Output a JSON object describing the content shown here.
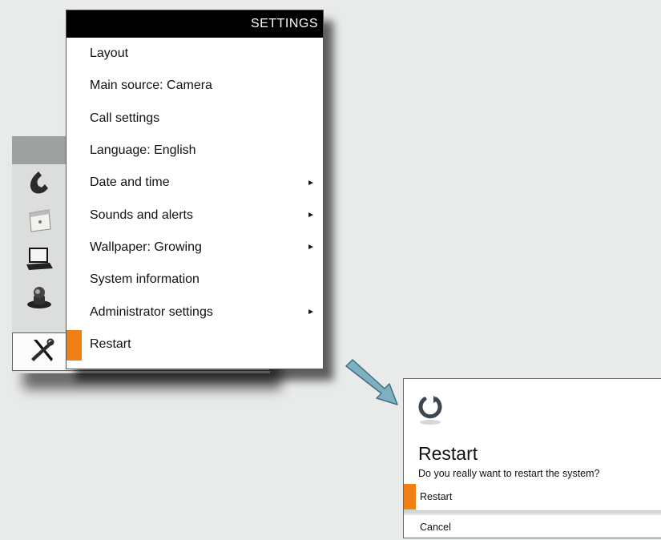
{
  "settings_menu": {
    "header": "SETTINGS",
    "items": [
      {
        "label": "Layout",
        "has_submenu": false
      },
      {
        "label": "Main source: Camera",
        "has_submenu": false
      },
      {
        "label": "Call settings",
        "has_submenu": false
      },
      {
        "label": "Language: English",
        "has_submenu": false
      },
      {
        "label": "Date and time",
        "has_submenu": true
      },
      {
        "label": "Sounds and alerts",
        "has_submenu": true
      },
      {
        "label": "Wallpaper: Growing",
        "has_submenu": true
      },
      {
        "label": "System information",
        "has_submenu": false
      },
      {
        "label": "Administrator settings",
        "has_submenu": true
      },
      {
        "label": "Restart",
        "has_submenu": false,
        "selected": true
      }
    ],
    "submenu_arrow": "►"
  },
  "sidebar": {
    "icons": [
      "phone-icon",
      "calendar-icon",
      "laptop-icon",
      "camera-icon",
      "tools-icon"
    ]
  },
  "dialog": {
    "icon": "restart-icon",
    "title": "Restart",
    "message": "Do you really want to restart the system?",
    "options": {
      "restart": "Restart",
      "cancel": "Cancel"
    }
  },
  "colors": {
    "accent": "#f07f16",
    "header_bg": "#000000",
    "background": "#e9ebea",
    "arrow": "#7fb0c2"
  }
}
